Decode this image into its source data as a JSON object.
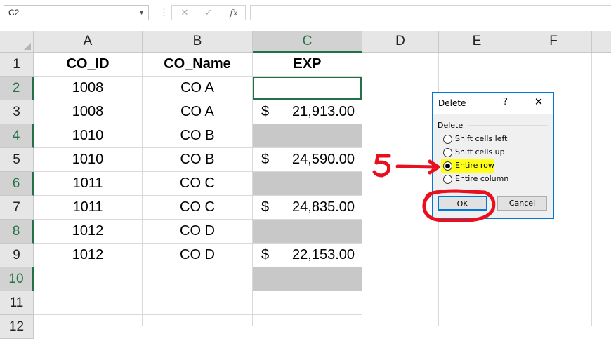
{
  "formula_bar": {
    "name_box": "C2",
    "fx_label": "fx",
    "formula": ""
  },
  "columns": [
    "A",
    "B",
    "C",
    "D",
    "E",
    "F"
  ],
  "rows": [
    "1",
    "2",
    "3",
    "4",
    "5",
    "6",
    "7",
    "8",
    "9",
    "10",
    "11",
    "12"
  ],
  "sheet": {
    "headers": {
      "a": "CO_ID",
      "b": "CO_Name",
      "c": "EXP"
    },
    "data": [
      {
        "id": "1008",
        "name": "CO A",
        "cur": "",
        "amount": ""
      },
      {
        "id": "1008",
        "name": "CO A",
        "cur": "$",
        "amount": "21,913.00"
      },
      {
        "id": "1010",
        "name": "CO B",
        "cur": "",
        "amount": ""
      },
      {
        "id": "1010",
        "name": "CO B",
        "cur": "$",
        "amount": "24,590.00"
      },
      {
        "id": "1011",
        "name": "CO C",
        "cur": "",
        "amount": ""
      },
      {
        "id": "1011",
        "name": "CO C",
        "cur": "$",
        "amount": "24,835.00"
      },
      {
        "id": "1012",
        "name": "CO D",
        "cur": "",
        "amount": ""
      },
      {
        "id": "1012",
        "name": "CO D",
        "cur": "$",
        "amount": "22,153.00"
      }
    ]
  },
  "dialog": {
    "title": "Delete",
    "help": "?",
    "close": "✕",
    "group_label": "Delete",
    "options": [
      "Shift cells left",
      "Shift cells up",
      "Entire row",
      "Entire column"
    ],
    "selected_option": "Entire row",
    "ok_label": "OK",
    "cancel_label": "Cancel"
  },
  "annotation": {
    "step_number": "5",
    "color": "#e8101e"
  },
  "colors": {
    "excel_green": "#217346",
    "selection_grey": "#c8c8c8",
    "dialog_accent": "#0078d7",
    "highlight_yellow": "#ffff1a"
  }
}
